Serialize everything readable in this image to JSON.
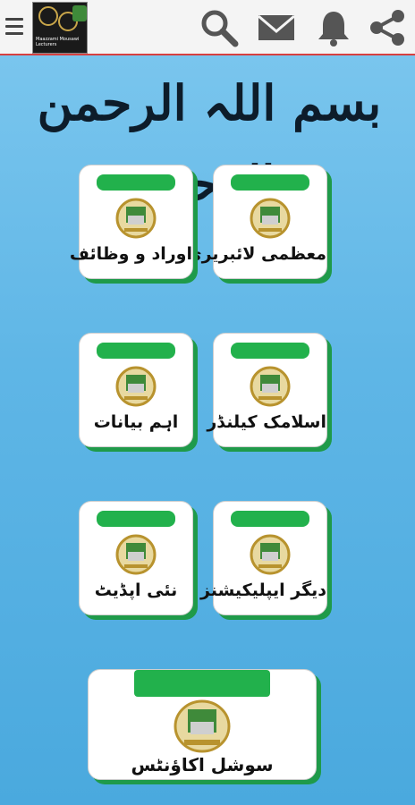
{
  "header": {
    "logo_text": "Maazzami Mousawi Lecturers"
  },
  "icons": {
    "menu": "menu-icon",
    "search": "search-icon",
    "mail": "mail-icon",
    "bell": "bell-icon",
    "share": "share-icon"
  },
  "bismillah": "بسم اللہ الرحمن الرحیم",
  "tiles": [
    {
      "label": "معظمی لائبریری"
    },
    {
      "label": "اوراد و وظائف"
    },
    {
      "label": "اسلامک کیلنڈر"
    },
    {
      "label": "اہم بیانات"
    },
    {
      "label": "دیگر ایپلیکیشنز"
    },
    {
      "label": "نئی اپڈیٹ"
    },
    {
      "label": "سوشل اکاؤنٹس"
    }
  ],
  "colors": {
    "accent_green": "#22b14c",
    "background_blue": "#5fb6e6",
    "header_border": "#d64040"
  }
}
